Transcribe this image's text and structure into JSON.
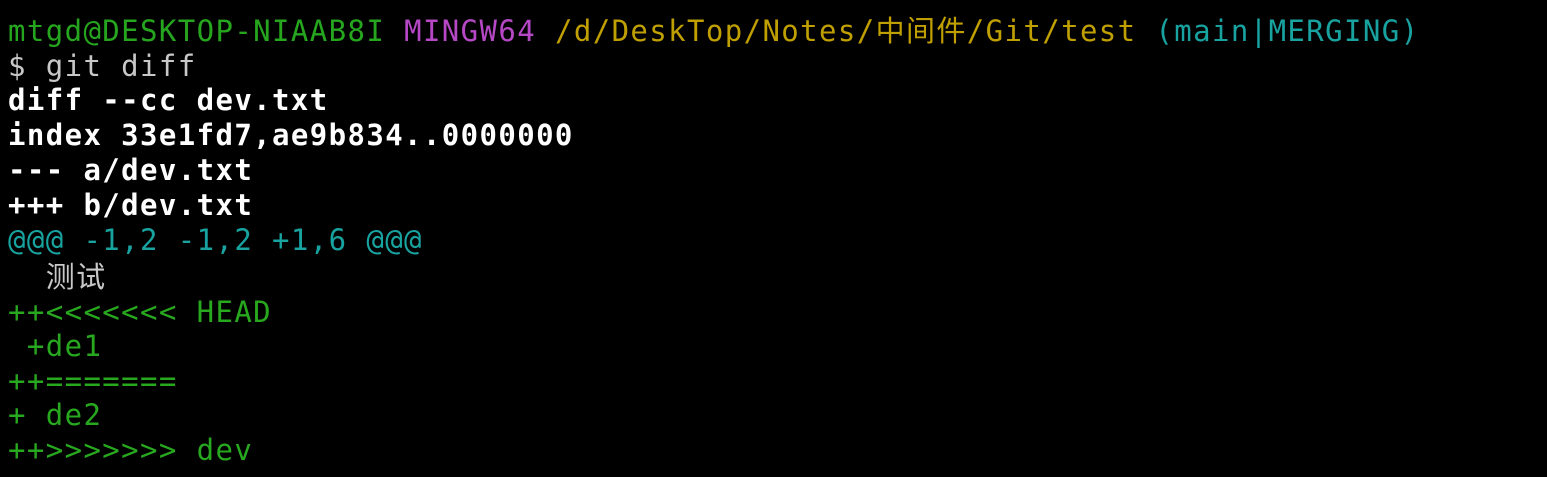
{
  "prompt": {
    "user_host": "mtgd@DESKTOP-NIAAB8I",
    "system": "MINGW64",
    "path": "/d/DeskTop/Notes/中间件/Git/test",
    "branch": "(main|MERGING)"
  },
  "command": "$ git diff",
  "diff": {
    "header": "diff --cc dev.txt",
    "index": "index 33e1fd7,ae9b834..0000000",
    "old_file": "--- a/dev.txt",
    "new_file": "+++ b/dev.txt",
    "hunk": "@@@ -1,2 -1,2 +1,6 @@@",
    "context": "  测试",
    "lines": [
      "++<<<<<<< HEAD",
      " +de1",
      "++=======",
      "+ de2",
      "++>>>>>>> dev"
    ]
  },
  "colors": {
    "background": "#000000",
    "prompt_green": "#26a61e",
    "prompt_magenta": "#b648c6",
    "prompt_yellow": "#c0a000",
    "prompt_cyan": "#18a3a0",
    "text_grey": "#c8c8c8",
    "text_white": "#ffffff"
  }
}
